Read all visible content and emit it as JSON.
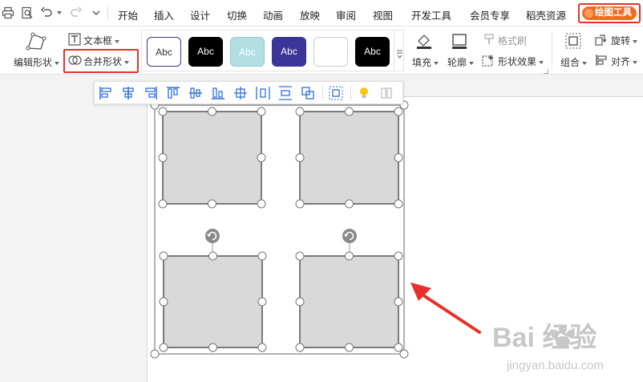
{
  "menubar": {
    "tabs": [
      "开始",
      "插入",
      "设计",
      "切换",
      "动画",
      "放映",
      "审阅",
      "视图",
      "开发工具",
      "会员专享",
      "稻壳资源"
    ],
    "active_tab": "绘图工具"
  },
  "ribbon": {
    "edit_shape": "编辑形状",
    "text_box": "文本框",
    "merge_shapes": "合并形状",
    "format_painter": "格式刷",
    "shape_effects": "形状效果",
    "fill": "填充",
    "outline": "轮廓",
    "group": "组合",
    "rotate": "旋转",
    "align": "对齐",
    "style_samples": [
      "Abc",
      "Abc",
      "Abc",
      "Abc",
      "",
      "Abc"
    ]
  },
  "colors": {
    "highlight_red": "#e8302a",
    "drawing_tab_orange": "#f06c22",
    "shape_fill": "#d9d9d9",
    "shape_stroke": "#555555",
    "align_icon_blue": "#2f6fd6",
    "arrow_red": "#e8302a",
    "watermark_gray": "#c7c7c7"
  },
  "watermark": {
    "brand": "Bai  经验",
    "url": "jingyan.baidu.com"
  }
}
